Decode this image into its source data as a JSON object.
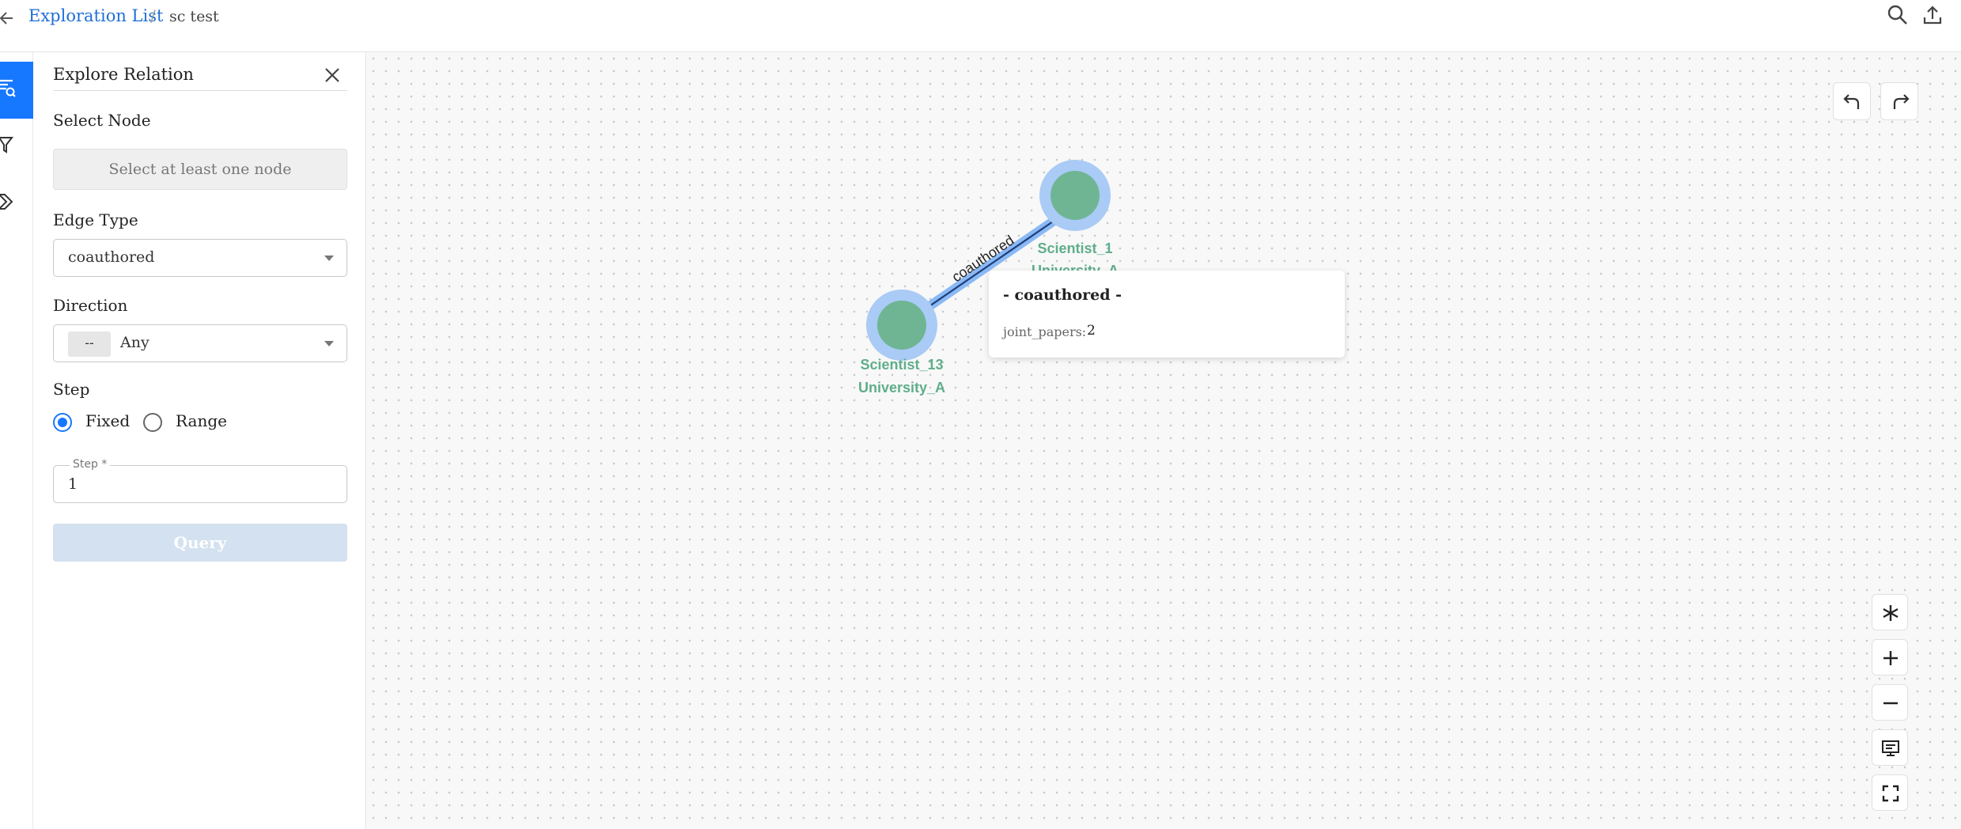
{
  "breadcrumb": {
    "parent": "Exploration List",
    "separator": "/",
    "current": "sc test"
  },
  "toolbar_icons": [
    "back-arrow-icon",
    "search-icon",
    "export-icon"
  ],
  "rail": {
    "items": [
      "explore-relation-icon",
      "filter-icon",
      "tag-icon"
    ],
    "active_index": 0
  },
  "panel": {
    "title": "Explore Relation",
    "select_node_label": "Select Node",
    "select_node_placeholder": "Select at least one node",
    "edge_type_label": "Edge Type",
    "edge_type_value": "coauthored",
    "direction_label": "Direction",
    "direction_tag": "--",
    "direction_value": "Any",
    "step_label": "Step",
    "step_options": [
      {
        "label": "Fixed",
        "checked": true
      },
      {
        "label": "Range",
        "checked": false
      }
    ],
    "step_field_label": "Step *",
    "step_field_value": "1",
    "query_button": "Query"
  },
  "graph": {
    "nodes": [
      {
        "id": "Scientist_1",
        "label": "Scientist_1",
        "sublabel": "University_A",
        "selected": true
      },
      {
        "id": "Scientist_13",
        "label": "Scientist_13",
        "sublabel": "University_A",
        "selected": true
      }
    ],
    "edges": [
      {
        "source": "Scientist_13",
        "target": "Scientist_1",
        "label": "coauthored"
      }
    ],
    "colors": {
      "node_fill": "#6fb594",
      "node_halo": "#a9cbf5",
      "label": "#5fae8c",
      "edge": "#1d3f7a",
      "edge_highlight": "#8ab9f5",
      "accent": "#1677ff"
    }
  },
  "tooltip": {
    "title": "- coauthored -",
    "property_key": "joint_papers:",
    "property_value": "2"
  },
  "canvas_controls": {
    "history": [
      "undo-icon",
      "redo-icon"
    ],
    "zoom": [
      "layout-icon",
      "zoom-in-icon",
      "zoom-out-icon",
      "presentation-icon",
      "fullscreen-icon"
    ]
  }
}
